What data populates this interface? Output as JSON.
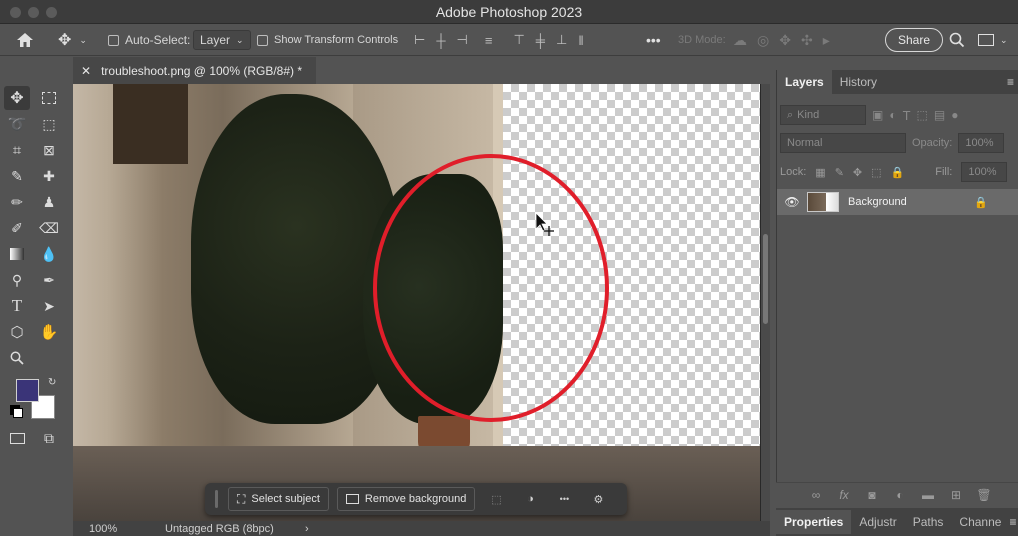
{
  "app": {
    "title": "Adobe Photoshop 2023"
  },
  "options_bar": {
    "auto_select_label": "Auto-Select:",
    "auto_select_value": "Layer",
    "show_transform_label": "Show Transform Controls",
    "mode_3d_label": "3D Mode:",
    "share_label": "Share"
  },
  "document": {
    "tab_title": "troubleshoot.png @ 100% (RGB/8#) *",
    "zoom": "100%",
    "color_profile": "Untagged RGB (8bpc)",
    "status_arrow": "›"
  },
  "contextual_taskbar": {
    "select_subject": "Select subject",
    "remove_background": "Remove background",
    "more": "•••"
  },
  "layers_panel": {
    "tabs": [
      "Layers",
      "History"
    ],
    "filter_kind": "Kind",
    "blend_mode": "Normal",
    "opacity_label": "Opacity:",
    "opacity_value": "100%",
    "lock_label": "Lock:",
    "fill_label": "Fill:",
    "fill_value": "100%",
    "layer_name": "Background"
  },
  "bottom_tabs": [
    "Properties",
    "Adjustr",
    "Paths",
    "Channe"
  ],
  "colors": {
    "foreground": "#3a3478",
    "background": "#ffffff",
    "annotation_circle": "#e01e2a"
  }
}
